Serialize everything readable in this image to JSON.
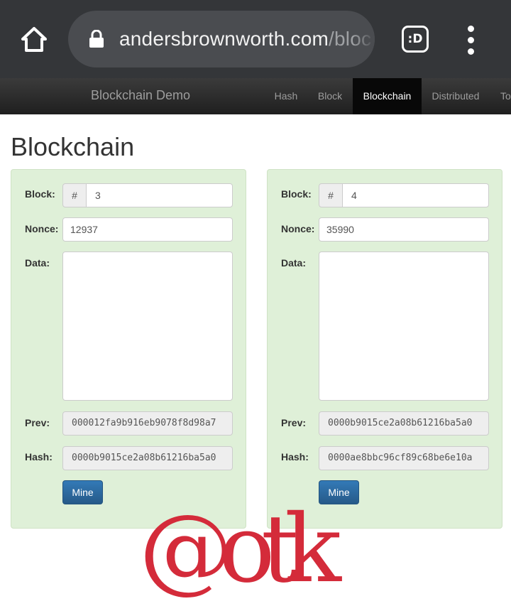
{
  "browser": {
    "url_host": "andersbrownworth.com",
    "url_path": "/bloc",
    "extension_label": ":D",
    "icons": {
      "home": "home-icon",
      "lock": "lock-icon",
      "extension": "extension-icon",
      "menu": "more-vert-icon"
    }
  },
  "navbar": {
    "brand": "Blockchain Demo",
    "items": [
      {
        "label": "Hash",
        "active": false
      },
      {
        "label": "Block",
        "active": false
      },
      {
        "label": "Blockchain",
        "active": true
      },
      {
        "label": "Distributed",
        "active": false
      },
      {
        "label": "To"
      }
    ]
  },
  "page": {
    "title": "Blockchain",
    "labels": {
      "block": "Block:",
      "nonce": "Nonce:",
      "data": "Data:",
      "prev": "Prev:",
      "hash": "Hash:",
      "hash_addon": "#",
      "mine": "Mine"
    },
    "blocks": [
      {
        "number": "3",
        "nonce": "12937",
        "data": "",
        "prev": "000012fa9b916eb9078f8d98a7",
        "hash": "0000b9015ce2a08b61216ba5a0"
      },
      {
        "number": "4",
        "nonce": "35990",
        "data": "",
        "prev": "0000b9015ce2a08b61216ba5a0",
        "hash": "0000ae8bbc96cf89c68be6e10a"
      }
    ]
  },
  "watermark": {
    "text": "@otk",
    "color": "#d42b3a"
  },
  "colors": {
    "chrome": "#343639",
    "panel": "#dff0d8",
    "primary_button": "#337ab7",
    "active_nav": "#080808"
  }
}
